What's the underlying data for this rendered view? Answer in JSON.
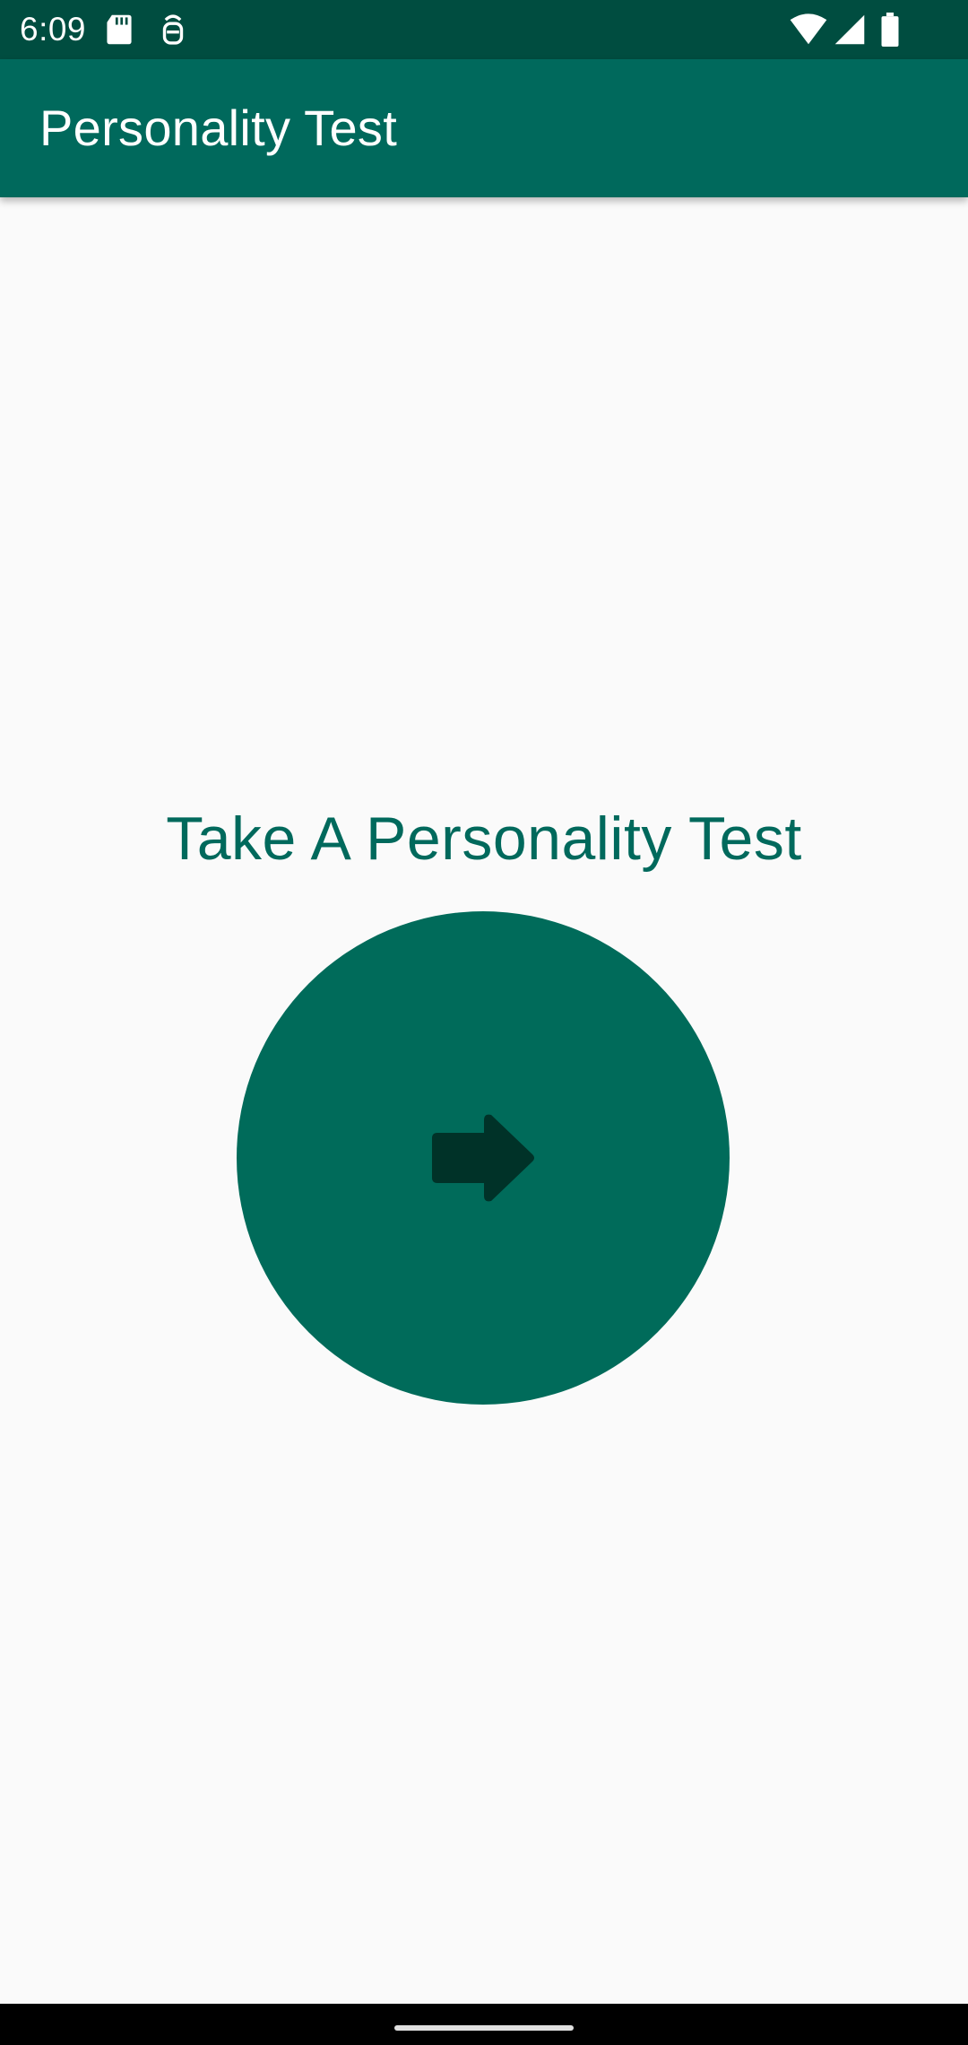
{
  "status_bar": {
    "time": "6:09",
    "icons": [
      "sd-card-icon",
      "sim-icon",
      "wifi-icon",
      "signal-icon",
      "battery-icon"
    ]
  },
  "app_bar": {
    "title": "Personality Test"
  },
  "main": {
    "headline": "Take A Personality Test",
    "start_button": {
      "icon": "arrow-right-icon"
    }
  },
  "colors": {
    "status_bar": "#004D40",
    "primary": "#00695C",
    "button": "#006B5A",
    "arrow": "#003228",
    "background": "#FAFAFA",
    "nav_bar": "#000000"
  }
}
